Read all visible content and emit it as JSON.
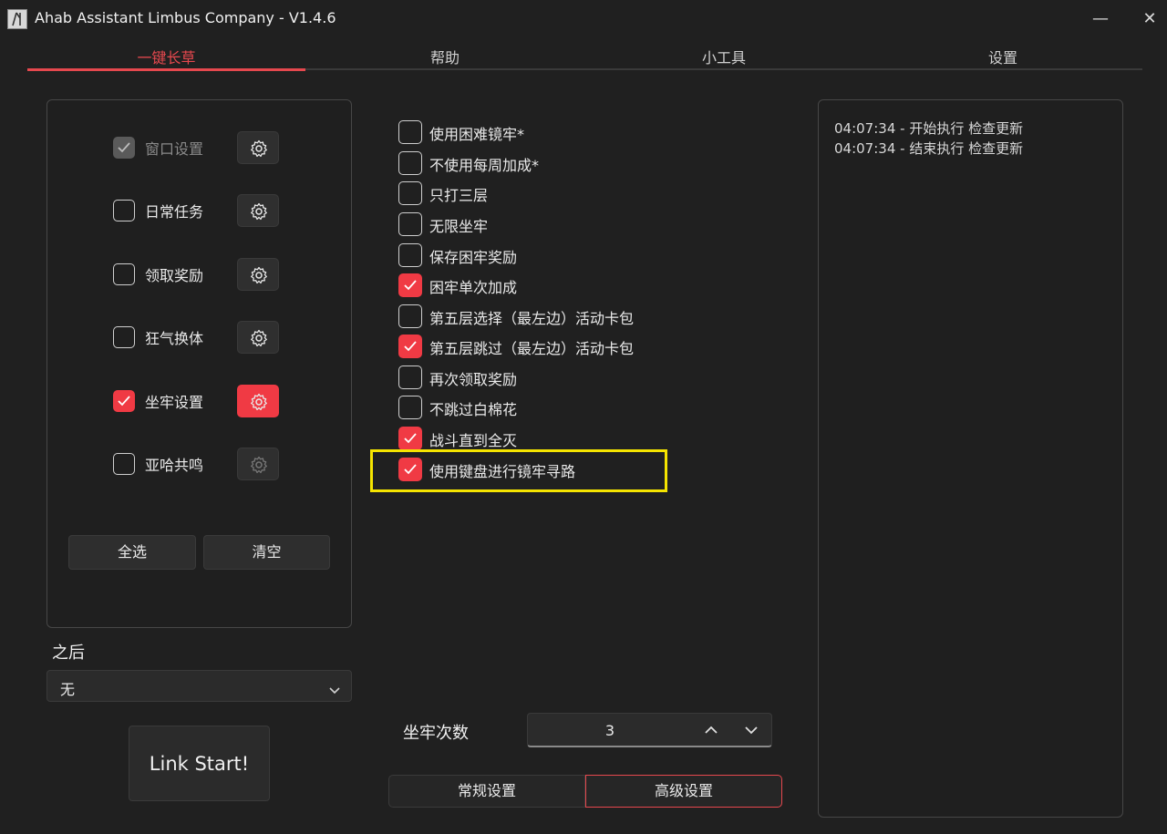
{
  "window": {
    "title": "Ahab Assistant Limbus Company - V1.4.6",
    "minimize_glyph": "—",
    "close_glyph": "✕"
  },
  "tabs": [
    "一键长草",
    "帮助",
    "小工具",
    "设置"
  ],
  "active_tab": "一键长草",
  "tasks": [
    {
      "label": "窗口设置",
      "checked": true,
      "disabled": true
    },
    {
      "label": "日常任务",
      "checked": false
    },
    {
      "label": "领取奖励",
      "checked": false
    },
    {
      "label": "狂气换体",
      "checked": false
    },
    {
      "label": "坐牢设置",
      "checked": true,
      "gear_active": true
    },
    {
      "label": "亚哈共鸣",
      "checked": false,
      "gear_disabled": true
    }
  ],
  "buttons": {
    "select_all": "全选",
    "clear": "清空",
    "link_start": "Link Start!"
  },
  "after": {
    "label": "之后",
    "value": "无"
  },
  "options": [
    {
      "label": "使用困难镜牢*",
      "checked": false
    },
    {
      "label": "不使用每周加成*",
      "checked": false
    },
    {
      "label": "只打三层",
      "checked": false
    },
    {
      "label": "无限坐牢",
      "checked": false
    },
    {
      "label": "保存困牢奖励",
      "checked": false
    },
    {
      "label": "困牢单次加成",
      "checked": true
    },
    {
      "label": "第五层选择（最左边）活动卡包",
      "checked": false
    },
    {
      "label": "第五层跳过（最左边）活动卡包",
      "checked": true
    },
    {
      "label": "再次领取奖励",
      "checked": false
    },
    {
      "label": "不跳过白棉花",
      "checked": false
    },
    {
      "label": "战斗直到全灭",
      "checked": true
    },
    {
      "label": "使用键盘进行镜牢寻路",
      "checked": true
    }
  ],
  "count": {
    "label": "坐牢次数",
    "value": "3"
  },
  "bottom_tabs": {
    "normal": "常规设置",
    "advanced": "高级设置"
  },
  "log": [
    "04:07:34 - 开始执行 检查更新",
    "04:07:34 - 结束执行 检查更新"
  ],
  "colors": {
    "accent": "#f03a44",
    "highlight": "#f5e400",
    "background": "#202020"
  }
}
